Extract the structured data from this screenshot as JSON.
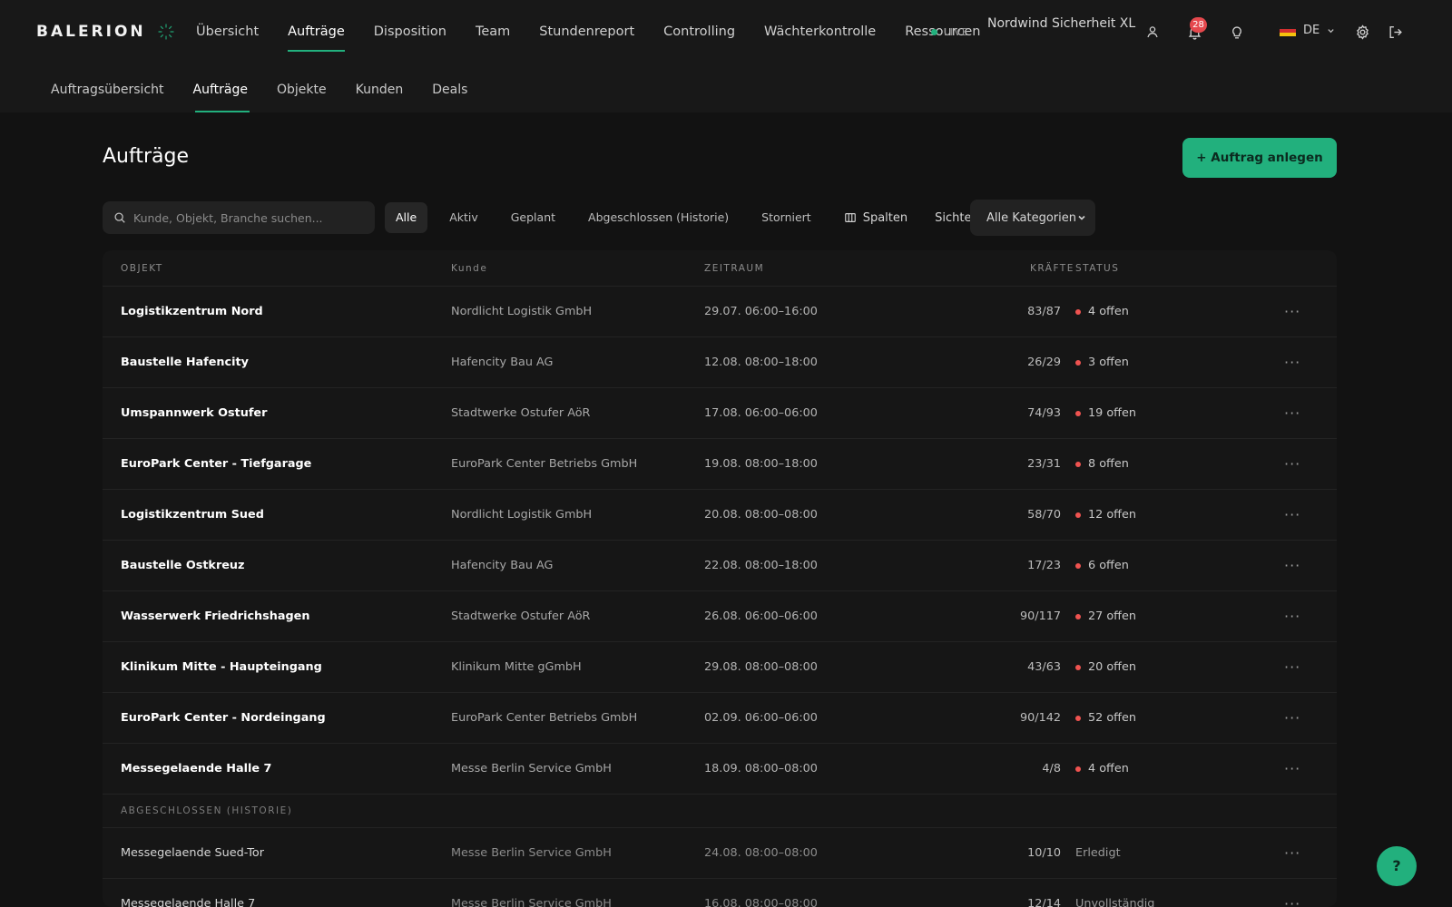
{
  "brand": {
    "name": "BALERION"
  },
  "main_nav": [
    {
      "label": "Übersicht",
      "active": false
    },
    {
      "label": "Aufträge",
      "active": true
    },
    {
      "label": "Disposition",
      "active": false
    },
    {
      "label": "Team",
      "active": false
    },
    {
      "label": "Stundenreport",
      "active": false
    },
    {
      "label": "Controlling",
      "active": false
    },
    {
      "label": "Wächterkontrolle",
      "active": false
    },
    {
      "label": "Ressourcen",
      "active": false
    }
  ],
  "status_indicator": {
    "label": "LIVE",
    "color": "#22b07d"
  },
  "company": "Nordwind Sicherheit XL",
  "notifications": {
    "count": "28"
  },
  "language": {
    "code": "DE"
  },
  "sub_nav": [
    {
      "label": "Auftragsübersicht",
      "active": false
    },
    {
      "label": "Aufträge",
      "active": true
    },
    {
      "label": "Objekte",
      "active": false
    },
    {
      "label": "Kunden",
      "active": false
    },
    {
      "label": "Deals",
      "active": false
    }
  ],
  "page": {
    "title": "Aufträge",
    "create_button": "+ Auftrag anlegen",
    "search_placeholder": "Kunde, Objekt, Branche suchen...",
    "filters": [
      {
        "label": "Alle",
        "active": true
      },
      {
        "label": "Aktiv",
        "active": false
      },
      {
        "label": "Geplant",
        "active": false
      },
      {
        "label": "Abgeschlossen (Historie)",
        "active": false
      },
      {
        "label": "Storniert",
        "active": false
      }
    ],
    "columns_button": "Spalten",
    "views_button": "Sichten",
    "category_select": "Alle Kategorien"
  },
  "table": {
    "headers": {
      "objekt": "OBJEKT",
      "kunde": "Kunde",
      "zeitraum": "ZEITRAUM",
      "kraefte": "KRÄFTE",
      "status": "STATUS"
    },
    "rows": [
      {
        "objekt": "Logistikzentrum Nord",
        "kunde": "Nordlicht Logistik GmbH",
        "zeitraum": "29.07. 06:00–16:00",
        "kraefte": "83/87",
        "status": "4 offen"
      },
      {
        "objekt": "Baustelle Hafencity",
        "kunde": "Hafencity Bau AG",
        "zeitraum": "12.08. 08:00–18:00",
        "kraefte": "26/29",
        "status": "3 offen"
      },
      {
        "objekt": "Umspannwerk Ostufer",
        "kunde": "Stadtwerke Ostufer AöR",
        "zeitraum": "17.08. 06:00–06:00",
        "kraefte": "74/93",
        "status": "19 offen"
      },
      {
        "objekt": "EuroPark Center - Tiefgarage",
        "kunde": "EuroPark Center Betriebs GmbH",
        "zeitraum": "19.08. 08:00–18:00",
        "kraefte": "23/31",
        "status": "8 offen"
      },
      {
        "objekt": "Logistikzentrum Sued",
        "kunde": "Nordlicht Logistik GmbH",
        "zeitraum": "20.08. 08:00–08:00",
        "kraefte": "58/70",
        "status": "12 offen"
      },
      {
        "objekt": "Baustelle Ostkreuz",
        "kunde": "Hafencity Bau AG",
        "zeitraum": "22.08. 08:00–18:00",
        "kraefte": "17/23",
        "status": "6 offen"
      },
      {
        "objekt": "Wasserwerk Friedrichshagen",
        "kunde": "Stadtwerke Ostufer AöR",
        "zeitraum": "26.08. 06:00–06:00",
        "kraefte": "90/117",
        "status": "27 offen"
      },
      {
        "objekt": "Klinikum Mitte - Haupteingang",
        "kunde": "Klinikum Mitte gGmbH",
        "zeitraum": "29.08. 08:00–08:00",
        "kraefte": "43/63",
        "status": "20 offen"
      },
      {
        "objekt": "EuroPark Center - Nordeingang",
        "kunde": "EuroPark Center Betriebs GmbH",
        "zeitraum": "02.09. 06:00–06:00",
        "kraefte": "90/142",
        "status": "52 offen"
      },
      {
        "objekt": "Messegelaende Halle 7",
        "kunde": "Messe Berlin Service GmbH",
        "zeitraum": "18.09. 08:00–08:00",
        "kraefte": "4/8",
        "status": "4 offen"
      }
    ],
    "history_label": "ABGESCHLOSSEN (HISTORIE)",
    "history_rows": [
      {
        "objekt": "Messegelaende Sued-Tor",
        "kunde": "Messe Berlin Service GmbH",
        "zeitraum": "24.08. 08:00–08:00",
        "kraefte": "10/10",
        "status": "Erledigt"
      },
      {
        "objekt": "Messegelaende Halle 7",
        "kunde": "Messe Berlin Service GmbH",
        "zeitraum": "16.08. 08:00–08:00",
        "kraefte": "12/14",
        "status": "Unvollständig"
      }
    ]
  },
  "help_button": "?",
  "colors": {
    "accent": "#22b07d",
    "danger": "#ef5350",
    "badge": "#e5484d",
    "background": "#121212"
  },
  "icons": [
    "logo-mark-icon",
    "user-icon",
    "bell-icon",
    "lightbulb-icon",
    "flag-de-icon",
    "chevron-down-icon",
    "gear-icon",
    "logout-icon",
    "search-icon",
    "columns-icon",
    "more-icon"
  ]
}
